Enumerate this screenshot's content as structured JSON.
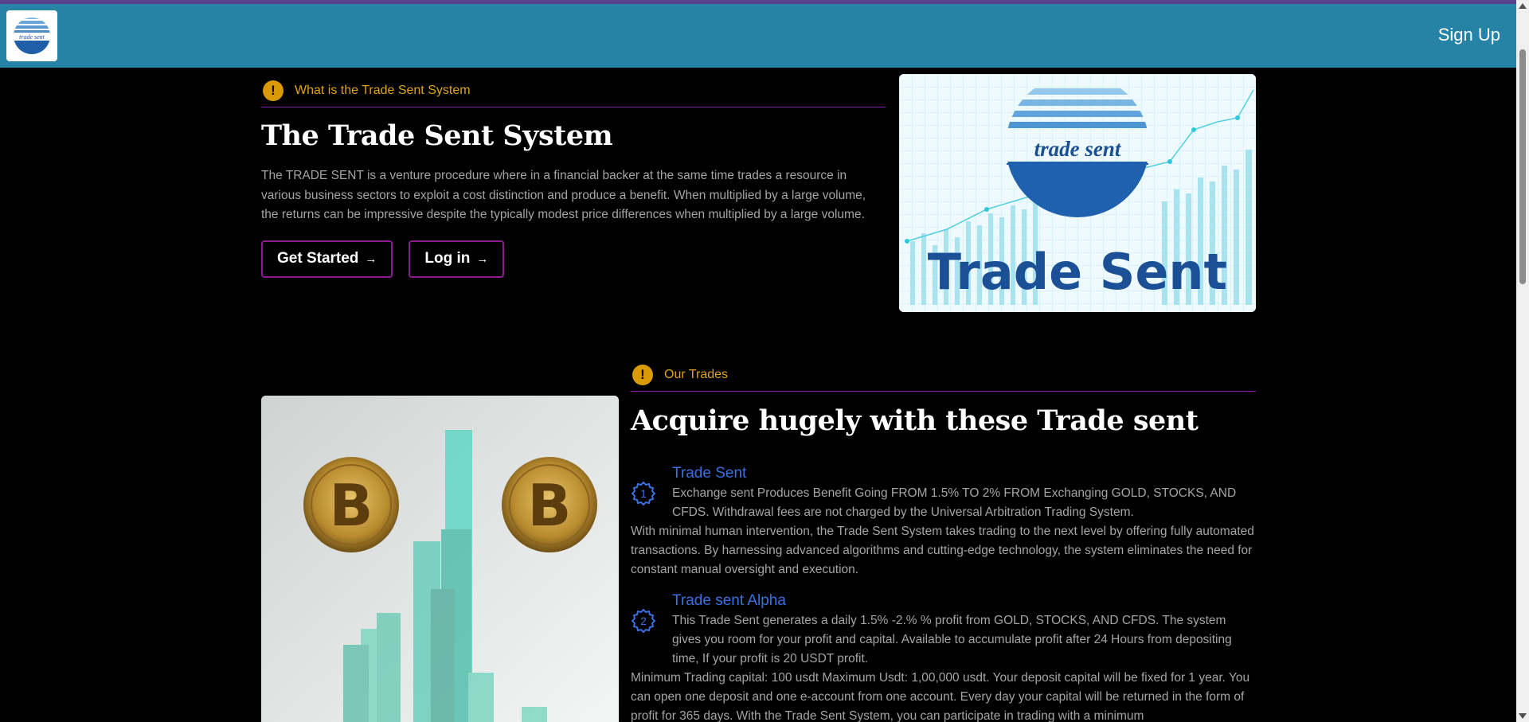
{
  "header": {
    "logo_text": "trade sent",
    "signup_label": "Sign Up"
  },
  "intro": {
    "eyebrow": "What is the Trade Sent System",
    "title": "The Trade Sent System",
    "description": "The TRADE SENT is a venture procedure where in a financial backer at the same time trades a resource in various business sectors to exploit a cost distinction and produce a benefit. When multiplied by a large volume, the returns can be impressive despite the typically modest price differences when multiplied by a large volume.",
    "get_started_label": "Get Started",
    "login_label": "Log in",
    "arrow": "→"
  },
  "hero_image": {
    "logo_text": "trade sent",
    "brand_text": "Trade Sent"
  },
  "trades": {
    "eyebrow": "Our Trades",
    "title": "Acquire hugely with these Trade sent",
    "features": [
      {
        "number": "1",
        "title": "Trade Sent",
        "text": "Exchange sent Produces Benefit Going FROM 1.5% TO 2% FROM Exchanging GOLD, STOCKS, AND CFDS. Withdrawal fees are not charged by the Universal Arbitration Trading System.",
        "more": "With minimal human intervention, the Trade Sent System takes trading to the next level by offering fully automated transactions. By harnessing advanced algorithms and cutting-edge technology, the system eliminates the need for constant manual oversight and execution."
      },
      {
        "number": "2",
        "title": "Trade sent Alpha",
        "text": "This Trade Sent generates a daily 1.5% -2.% % profit from GOLD, STOCKS, AND CFDS. The system gives you room for your profit and capital. Available to accumulate profit after 24 Hours from depositing time, If your profit is 20 USDT profit.",
        "more": "Minimum Trading capital: 100 usdt Maximum Usdt: 1,00,000 usdt. Your deposit capital will be fixed for 1 year. You can open one deposit and one e-account from one account. Every day your capital will be returned in the form of profit for 365 days. With the Trade Sent System, you can participate in trading with a minimum"
      }
    ]
  },
  "colors": {
    "header_bg": "#2683a6",
    "accent_orange": "#e0a31c",
    "button_border": "#8a1c8e",
    "feature_blue": "#3a6fe0"
  }
}
